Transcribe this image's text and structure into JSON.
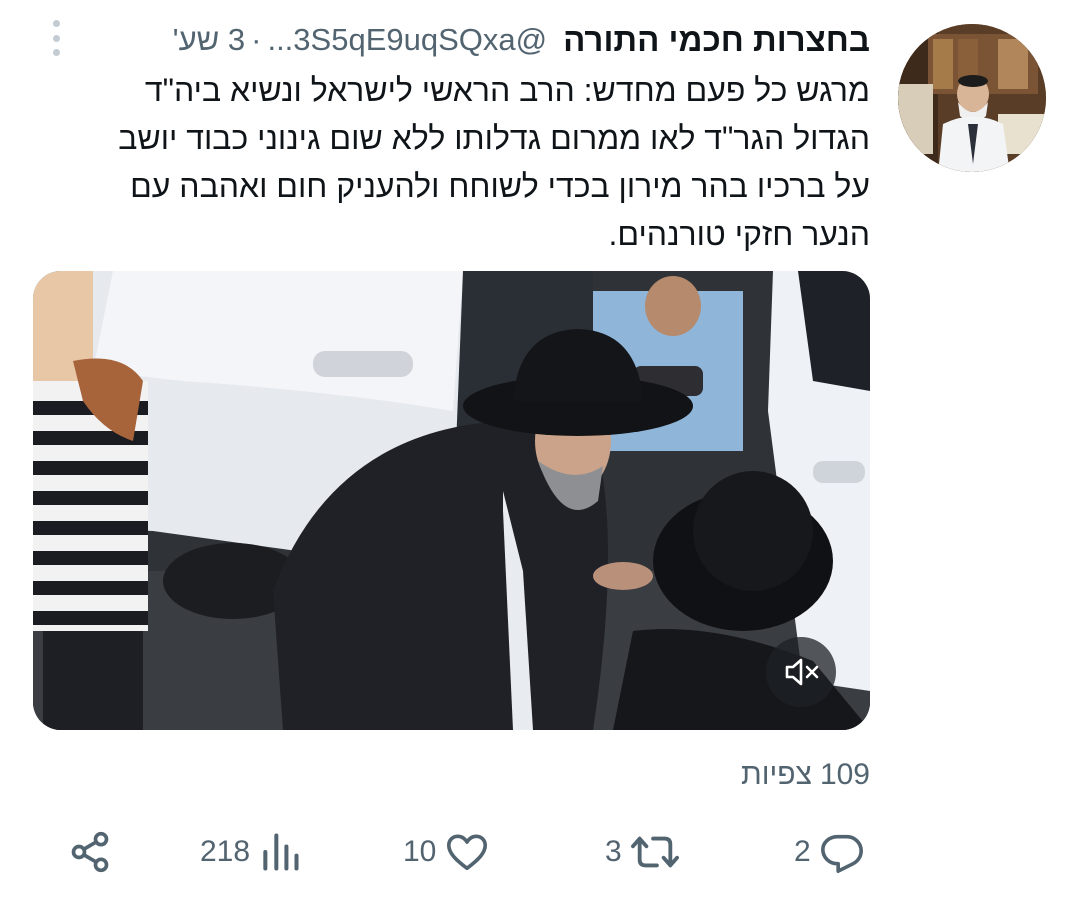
{
  "author": {
    "display_name": "בחצרות חכמי התורה",
    "handle": "@3S5qE9uqSQxa...",
    "separator": "·",
    "time": "3 שע'"
  },
  "tweet": {
    "lines": [
      "מרגש כל פעם מחדש: הרב הראשי לישראל ונשיא ביה\"ד",
      "הגדול הגר\"ד לאו ממרום גדלותו ללא שום גינוני כבוד יושב",
      "על ברכיו בהר מירון בכדי לשוחח ולהעניק חום ואהבה עם",
      "הנער חזקי טורנהים."
    ]
  },
  "media": {
    "type": "video",
    "muted_icon": "speaker-muted-icon"
  },
  "views": {
    "count": "109",
    "label": "צפיות"
  },
  "actions": {
    "replies": "2",
    "retweets": "3",
    "likes": "10",
    "analytics": "218"
  },
  "icons": {
    "reply": "reply-icon",
    "retweet": "retweet-icon",
    "like": "heart-icon",
    "analytics": "analytics-icon",
    "share": "share-icon",
    "more": "more-options-icon"
  },
  "colors": {
    "text": "#0f1419",
    "secondary": "#536471"
  }
}
